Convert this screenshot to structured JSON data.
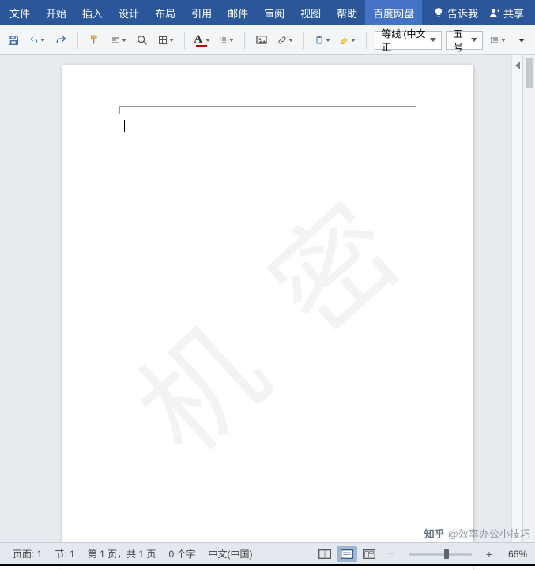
{
  "menu": {
    "items": [
      "文件",
      "开始",
      "插入",
      "设计",
      "布局",
      "引用",
      "邮件",
      "审阅",
      "视图",
      "帮助",
      "百度网盘"
    ],
    "active_index": 10,
    "tell_me": "告诉我",
    "share": "共享"
  },
  "toolbar": {
    "font_name": "等线 (中文正",
    "font_size": "五号"
  },
  "document": {
    "watermark_text": "机 密"
  },
  "status": {
    "page_label": "页面:",
    "page_value": "1",
    "section_label": "节:",
    "section_value": "1",
    "page_of": "第 1 页，共 1 页",
    "word_count": "0 个字",
    "language": "中文(中国)",
    "zoom_value": "66%"
  },
  "credit": {
    "brand": "知乎",
    "author": "@效率办公小技巧"
  }
}
